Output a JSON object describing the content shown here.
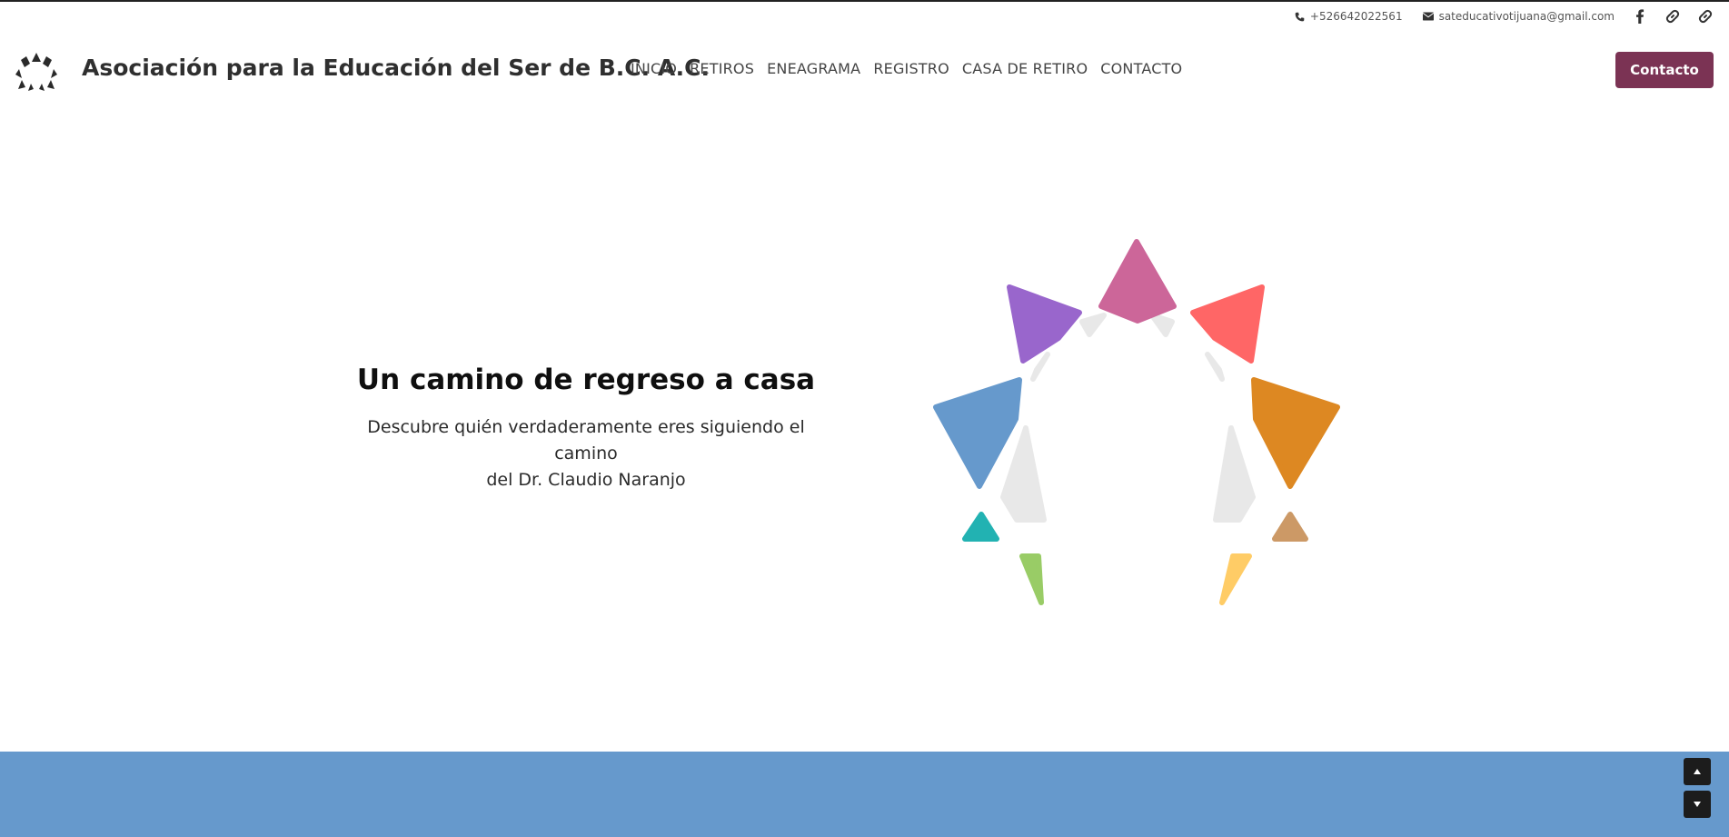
{
  "topbar": {
    "phone": "+526642022561",
    "email": "sateducativotijuana@gmail.com",
    "social_icons": [
      "facebook-icon",
      "link-icon",
      "link-icon"
    ]
  },
  "header": {
    "brand": "Asociación para la Educación del Ser de B.C. A.C.",
    "nav": [
      "INICIO",
      "RETIROS",
      "ENEAGRAMA",
      "REGISTRO",
      "CASA DE RETIRO",
      "CONTACTO"
    ],
    "cta_label": "Contacto"
  },
  "hero": {
    "title": "Un camino de regreso a casa",
    "subtitle_line1": "Descubre quién verdaderamente eres siguiendo el camino",
    "subtitle_line2": "del Dr. Claudio Naranjo"
  },
  "colors": {
    "cta": "#7b3354",
    "band": "#6699cc",
    "enneagram": [
      "#cc6699",
      "#ff6666",
      "#dd8822",
      "#cc9966",
      "#ffcc66",
      "#99cc66",
      "#22b2b2",
      "#6699cc",
      "#9966cc"
    ]
  }
}
